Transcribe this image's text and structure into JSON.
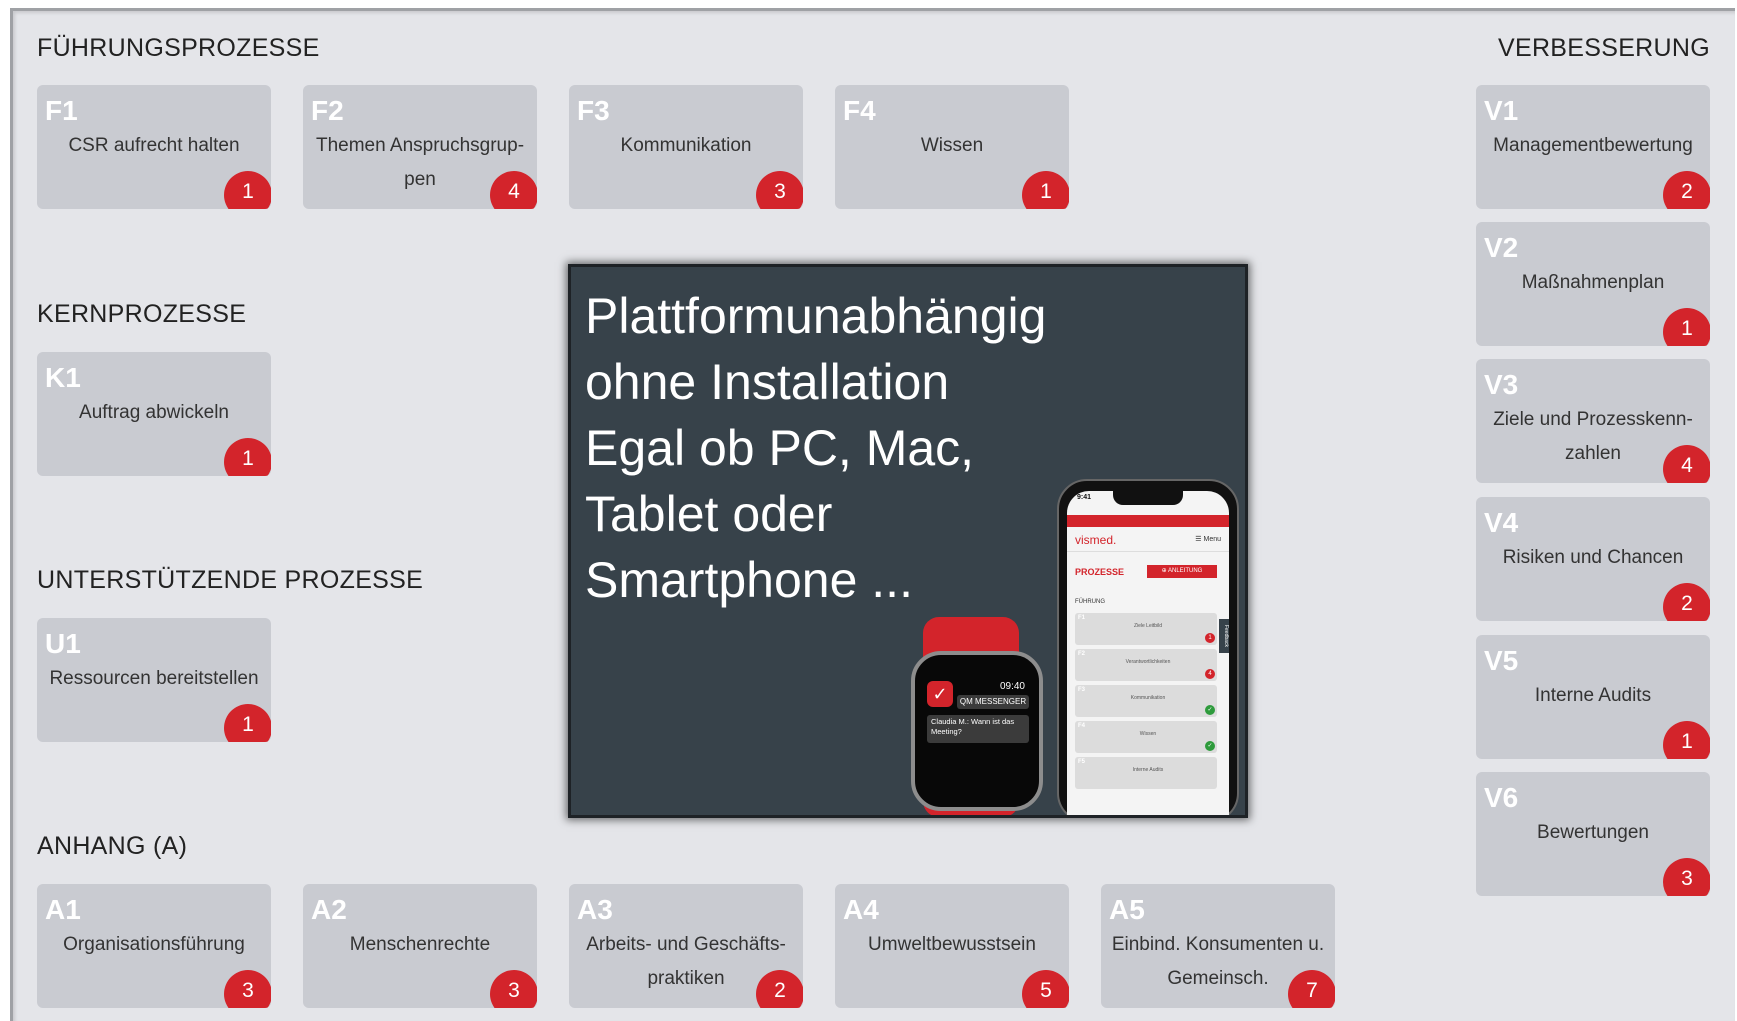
{
  "sections": {
    "fuehrung": "FÜHRUNGSPROZESSE",
    "kern": "KERNPROZESSE",
    "unterstuetzend": "UNTERSTÜTZENDE PROZESSE",
    "anhang": "ANHANG (A)",
    "verbesserung": "VERBESSERUNG"
  },
  "fuehrung": [
    {
      "code": "F1",
      "label": "CSR aufrecht halten",
      "count": "1"
    },
    {
      "code": "F2",
      "label": "Themen Anspruchsgrup-pen",
      "count": "4"
    },
    {
      "code": "F3",
      "label": "Kommunikation",
      "count": "3"
    },
    {
      "code": "F4",
      "label": "Wissen",
      "count": "1"
    }
  ],
  "kern": [
    {
      "code": "K1",
      "label": "Auftrag abwickeln",
      "count": "1"
    }
  ],
  "unterstuetzend": [
    {
      "code": "U1",
      "label": "Ressourcen bereitstellen",
      "count": "1"
    }
  ],
  "anhang": [
    {
      "code": "A1",
      "label": "Organisationsführung",
      "count": "3"
    },
    {
      "code": "A2",
      "label": "Menschenrechte",
      "count": "3"
    },
    {
      "code": "A3",
      "label": "Arbeits- und Geschäfts-praktiken",
      "count": "2"
    },
    {
      "code": "A4",
      "label": "Umweltbewusstsein",
      "count": "5"
    },
    {
      "code": "A5",
      "label": "Einbind. Konsumenten u. Gemeinsch.",
      "count": "7"
    }
  ],
  "verbesserung": [
    {
      "code": "V1",
      "label": "Managementbewertung",
      "count": "2"
    },
    {
      "code": "V2",
      "label": "Maßnahmenplan",
      "count": "1"
    },
    {
      "code": "V3",
      "label": "Ziele und Prozesskenn-zahlen",
      "count": "4"
    },
    {
      "code": "V4",
      "label": "Risiken und Chancen",
      "count": "2"
    },
    {
      "code": "V5",
      "label": "Interne Audits",
      "count": "1"
    },
    {
      "code": "V6",
      "label": "Bewertungen",
      "count": "3"
    }
  ],
  "promo": {
    "lines": [
      "Plattformunabhängig",
      "ohne Installation",
      "Egal ob PC, Mac,",
      "Tablet oder",
      "Smartphone ..."
    ],
    "phone": {
      "time": "9:41",
      "brand": "vismed.",
      "menu": "☰ Menu",
      "heading": "PROZESSE",
      "button": "⊕ ANLEITUNG",
      "section": "FÜHRUNG",
      "feedback": "Feedback",
      "rows": [
        {
          "code": "F1",
          "label": "Ziele Leitbild",
          "status": "1"
        },
        {
          "code": "F2",
          "label": "Verantwortlichkeiten",
          "status": "4"
        },
        {
          "code": "F3",
          "label": "Kommunikation",
          "status": "✓"
        },
        {
          "code": "F4",
          "label": "Wissen",
          "status": "✓"
        },
        {
          "code": "F5",
          "label": "Interne Audits",
          "status": ""
        }
      ]
    },
    "watch": {
      "time": "09:40",
      "app": "QM MESSENGER",
      "message": "Claudia M.: Wann ist das Meeting?"
    }
  }
}
